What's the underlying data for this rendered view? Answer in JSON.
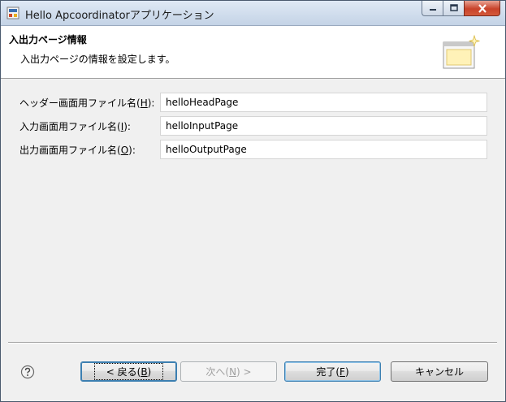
{
  "window": {
    "title": "Hello Apcoordinatorアプリケーション"
  },
  "header": {
    "title": "入出力ページ情報",
    "description": "入出力ページの情報を設定します。"
  },
  "fields": [
    {
      "label_pre": "ヘッダー画面用ファイル名(",
      "mnemonic": "H",
      "label_post": "):",
      "value": "helloHeadPage"
    },
    {
      "label_pre": "入力画面用ファイル名(",
      "mnemonic": "I",
      "label_post": "):",
      "value": "helloInputPage"
    },
    {
      "label_pre": "出力画面用ファイル名(",
      "mnemonic": "O",
      "label_post": "):",
      "value": "helloOutputPage"
    }
  ],
  "buttons": {
    "back": {
      "pre": "< 戻る(",
      "mnemonic": "B",
      "post": ")"
    },
    "next": {
      "pre": "次へ(",
      "mnemonic": "N",
      "post": ") >"
    },
    "finish": {
      "pre": "完了(",
      "mnemonic": "F",
      "post": ")"
    },
    "cancel": "キャンセル"
  },
  "colors": {
    "accent": "#3c7fb1",
    "close_button": "#c8432a"
  },
  "icons": {
    "app": "java-app-icon",
    "header": "wizard-banner-icon",
    "help": "help-icon"
  }
}
